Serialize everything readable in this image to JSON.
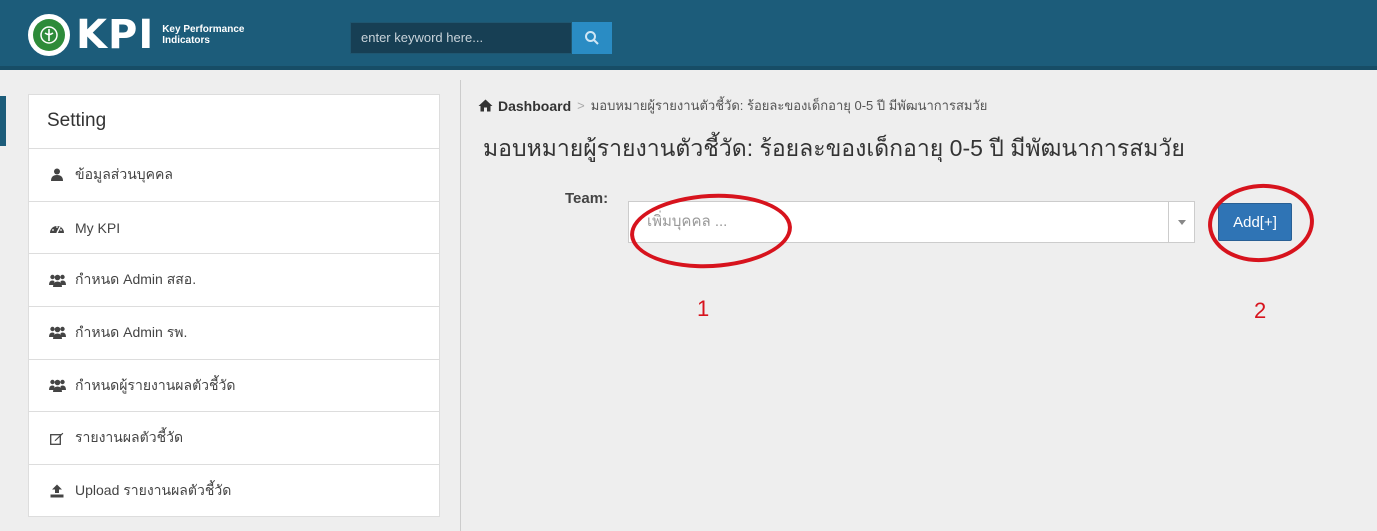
{
  "header": {
    "logo_text": "KPI",
    "logo_subtitle_1": "Key Performance",
    "logo_subtitle_2": "Indicators",
    "search_placeholder": "enter keyword here..."
  },
  "sidebar": {
    "title": "Setting",
    "items": [
      {
        "label": "ข้อมูลส่วนบุคคล",
        "icon": "user-icon"
      },
      {
        "label": "My KPI",
        "icon": "dashboard-icon"
      },
      {
        "label": "กำหนด Admin สสอ.",
        "icon": "users-icon"
      },
      {
        "label": "กำหนด Admin รพ.",
        "icon": "users-icon"
      },
      {
        "label": "กำหนดผู้รายงานผลตัวชี้วัด",
        "icon": "users-icon"
      },
      {
        "label": "รายงานผลตัวชี้วัด",
        "icon": "edit-icon"
      },
      {
        "label": "Upload รายงานผลตัวชี้วัด",
        "icon": "upload-icon"
      }
    ]
  },
  "breadcrumb": {
    "home": "Dashboard",
    "current": "มอบหมายผู้รายงานตัวชี้วัด: ร้อยละของเด็กอายุ 0-5 ปี มีพัฒนาการสมวัย"
  },
  "main": {
    "title": "มอบหมายผู้รายงานตัวชี้วัด: ร้อยละของเด็กอายุ 0-5 ปี มีพัฒนาการสมวัย",
    "team_label": "Team:",
    "select_placeholder": "เพิ่มบุคคล ...",
    "add_button": "Add[+]"
  },
  "annotations": {
    "label_1": "1",
    "label_2": "2",
    "color": "#d7131d"
  },
  "colors": {
    "navbar": "#1c5c7a",
    "primary_button": "#2f74b5",
    "search_button": "#2a8cc4"
  }
}
